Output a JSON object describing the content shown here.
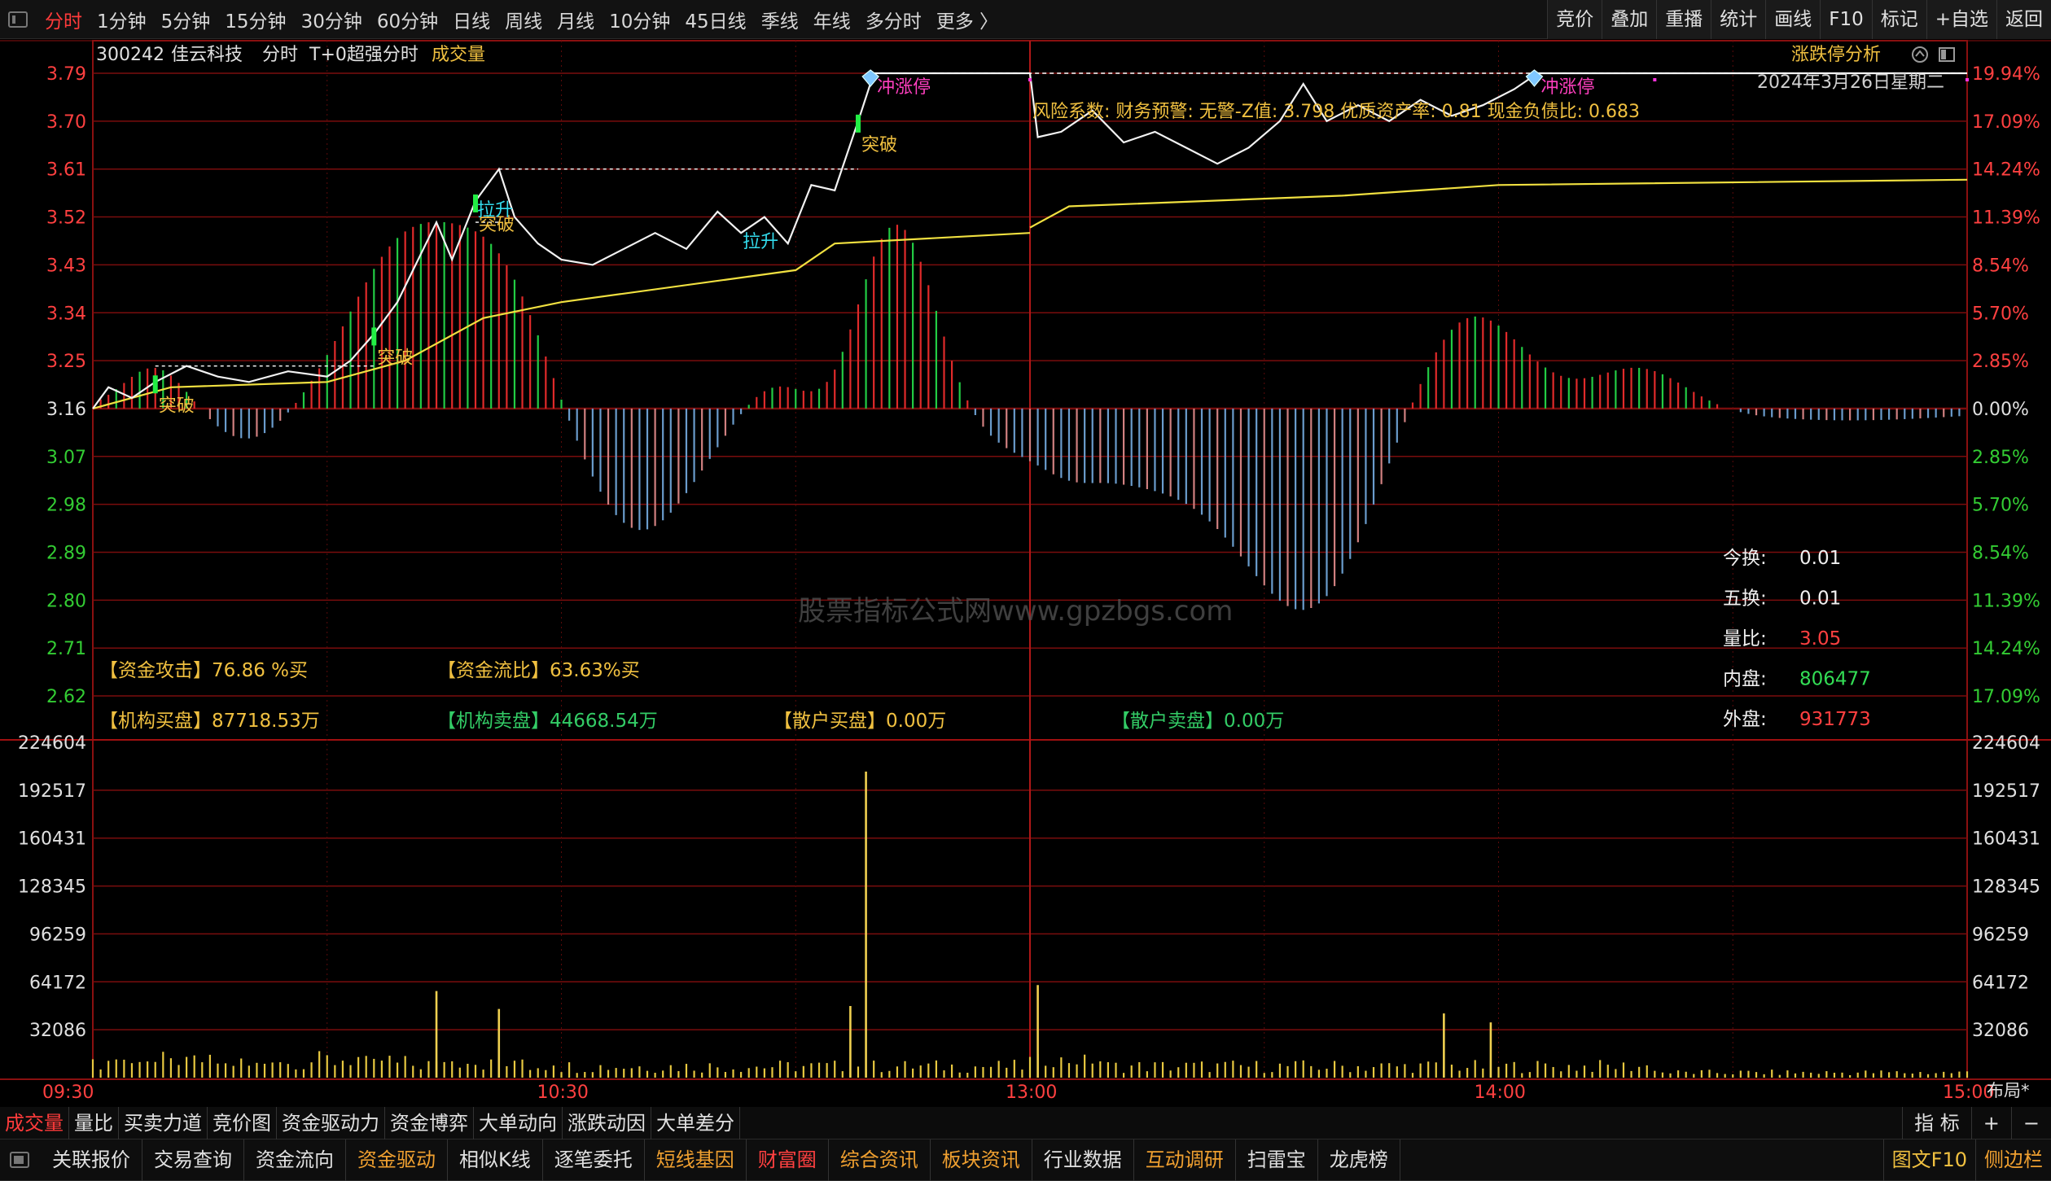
{
  "period_tabs": [
    "分时",
    "1分钟",
    "5分钟",
    "15分钟",
    "30分钟",
    "60分钟",
    "日线",
    "周线",
    "月线",
    "10分钟",
    "45日线",
    "季线",
    "年线",
    "多分时",
    "更多 〉"
  ],
  "active_period": "分时",
  "right_tools": [
    "竞价",
    "叠加",
    "重播",
    "统计",
    "画线",
    "F10",
    "标记",
    "+自选",
    "返回"
  ],
  "header": {
    "code": "300242",
    "name": "佳云科技",
    "mode": "分时",
    "indicator": "T+0超强分时",
    "volume_label": "成交量",
    "limit_label": "涨跌停分析",
    "date": "2024年3月26日星期二"
  },
  "price_axis": {
    "left": [
      "3.79",
      "3.70",
      "3.61",
      "3.52",
      "3.43",
      "3.34",
      "3.25",
      "3.16",
      "3.07",
      "2.98",
      "2.89",
      "2.80",
      "2.71",
      "2.62"
    ],
    "right": [
      "19.94%",
      "17.09%",
      "14.24%",
      "11.39%",
      "8.54%",
      "5.70%",
      "2.85%",
      "0.00%",
      "2.85%",
      "5.70%",
      "8.54%",
      "11.39%",
      "14.24%",
      "17.09%"
    ]
  },
  "volume_axis": [
    "224604",
    "192517",
    "160431",
    "128345",
    "96259",
    "64172",
    "32086"
  ],
  "time_axis": [
    "09:30",
    "10:30",
    "13:00",
    "14:00",
    "15:00"
  ],
  "layout_label": "布局*",
  "signals": {
    "breakout": "突破",
    "pull_up": "拉升",
    "limit_attempt": "冲涨停"
  },
  "risk_line": "风险系数: 财务预警: 无警-Z值: 3.798 优质资产率: 0.81 现金负债比: 0.683",
  "stats": [
    {
      "label": "今换:",
      "value": "0.01"
    },
    {
      "label": "五换:",
      "value": "0.01"
    },
    {
      "label": "量比:",
      "value": "3.05"
    },
    {
      "label": "内盘:",
      "value": "806477"
    },
    {
      "label": "外盘:",
      "value": "931773"
    }
  ],
  "fund_info": {
    "attack": "【资金攻击】76.86 %买",
    "flow_ratio": "【资金流比】63.63%买",
    "inst_buy": "【机构买盘】87718.53万",
    "inst_sell": "【机构卖盘】44668.54万",
    "retail_buy": "【散户买盘】0.00万",
    "retail_sell": "【散户卖盘】0.00万"
  },
  "watermark": "股票指标公式网www.gpzbgs.com",
  "indicator_tabs": [
    "成交量",
    "量比",
    "买卖力道",
    "竞价图",
    "资金驱动力",
    "资金博弈",
    "大单动向",
    "涨跌动因",
    "大单差分"
  ],
  "active_indicator_tab": "成交量",
  "tabbar_right": [
    "指 标",
    "+",
    "−"
  ],
  "bottom_tabs": [
    {
      "label": "关联报价",
      "color": "#e0e0e0"
    },
    {
      "label": "交易查询",
      "color": "#e0e0e0"
    },
    {
      "label": "资金流向",
      "color": "#e0e0e0"
    },
    {
      "label": "资金驱动",
      "color": "#f0a030"
    },
    {
      "label": "相似K线",
      "color": "#e0e0e0"
    },
    {
      "label": "逐笔委托",
      "color": "#e0e0e0"
    },
    {
      "label": "短线基因",
      "color": "#f0a030"
    },
    {
      "label": "财富圈",
      "color": "#ff4040"
    },
    {
      "label": "综合资讯",
      "color": "#f0a030"
    },
    {
      "label": "板块资讯",
      "color": "#f0a030"
    },
    {
      "label": "行业数据",
      "color": "#e0e0e0"
    },
    {
      "label": "互动调研",
      "color": "#f0a030"
    },
    {
      "label": "扫雷宝",
      "color": "#e0e0e0"
    },
    {
      "label": "龙虎榜",
      "color": "#e0e0e0"
    }
  ],
  "bottom_right": [
    "图文F10",
    "侧边栏"
  ],
  "chart_data": {
    "type": "line",
    "title": "300242 佳云科技 分时",
    "xlabel": "",
    "ylabel": "",
    "prev_close": 3.16,
    "limit_up": 3.79,
    "ylim_price": [
      2.62,
      3.79
    ],
    "ylim_volume": [
      0,
      224604
    ],
    "price_series": {
      "name": "price",
      "points": [
        [
          "09:30",
          3.16
        ],
        [
          "09:32",
          3.2
        ],
        [
          "09:35",
          3.18
        ],
        [
          "09:38",
          3.21
        ],
        [
          "09:42",
          3.24
        ],
        [
          "09:46",
          3.22
        ],
        [
          "09:50",
          3.21
        ],
        [
          "09:55",
          3.23
        ],
        [
          "10:00",
          3.22
        ],
        [
          "10:03",
          3.25
        ],
        [
          "10:06",
          3.3
        ],
        [
          "10:09",
          3.36
        ],
        [
          "10:12",
          3.45
        ],
        [
          "10:14",
          3.51
        ],
        [
          "10:16",
          3.44
        ],
        [
          "10:19",
          3.55
        ],
        [
          "10:22",
          3.61
        ],
        [
          "10:24",
          3.52
        ],
        [
          "10:27",
          3.47
        ],
        [
          "10:30",
          3.44
        ],
        [
          "10:34",
          3.43
        ],
        [
          "10:38",
          3.46
        ],
        [
          "10:42",
          3.49
        ],
        [
          "10:46",
          3.46
        ],
        [
          "10:50",
          3.53
        ],
        [
          "10:53",
          3.49
        ],
        [
          "10:56",
          3.52
        ],
        [
          "10:59",
          3.47
        ],
        [
          "11:02",
          3.58
        ],
        [
          "11:05",
          3.57
        ],
        [
          "11:08",
          3.7
        ],
        [
          "11:10",
          3.79
        ],
        [
          "11:30",
          3.79
        ],
        [
          "13:00",
          3.79
        ],
        [
          "13:01",
          3.67
        ],
        [
          "13:04",
          3.68
        ],
        [
          "13:08",
          3.72
        ],
        [
          "13:12",
          3.66
        ],
        [
          "13:16",
          3.68
        ],
        [
          "13:20",
          3.65
        ],
        [
          "13:24",
          3.62
        ],
        [
          "13:28",
          3.65
        ],
        [
          "13:32",
          3.7
        ],
        [
          "13:35",
          3.77
        ],
        [
          "13:38",
          3.7
        ],
        [
          "13:42",
          3.73
        ],
        [
          "13:46",
          3.7
        ],
        [
          "13:50",
          3.74
        ],
        [
          "13:54",
          3.71
        ],
        [
          "13:58",
          3.73
        ],
        [
          "14:02",
          3.76
        ],
        [
          "14:05",
          3.79
        ],
        [
          "14:10",
          3.79
        ],
        [
          "15:00",
          3.79
        ]
      ]
    },
    "avg_series": {
      "name": "average",
      "points": [
        [
          "09:30",
          3.16
        ],
        [
          "09:40",
          3.2
        ],
        [
          "10:00",
          3.21
        ],
        [
          "10:10",
          3.25
        ],
        [
          "10:20",
          3.33
        ],
        [
          "10:30",
          3.36
        ],
        [
          "11:00",
          3.42
        ],
        [
          "11:05",
          3.47
        ],
        [
          "11:30",
          3.49
        ],
        [
          "13:00",
          3.5
        ],
        [
          "13:05",
          3.54
        ],
        [
          "13:40",
          3.56
        ],
        [
          "14:00",
          3.58
        ],
        [
          "15:00",
          3.59
        ]
      ]
    },
    "signal_points": [
      {
        "time": "09:38",
        "label": "突破"
      },
      {
        "time": "10:06",
        "label": "突破"
      },
      {
        "time": "10:19",
        "label": "突破"
      },
      {
        "time": "10:19",
        "label": "拉升"
      },
      {
        "time": "10:53",
        "label": "拉升"
      },
      {
        "time": "11:08",
        "label": "突破"
      },
      {
        "time": "11:10",
        "label": "冲涨停"
      },
      {
        "time": "14:05",
        "label": "冲涨停"
      }
    ],
    "volume_spikes": [
      {
        "time": "10:14",
        "value": 58000
      },
      {
        "time": "10:22",
        "value": 46000
      },
      {
        "time": "11:07",
        "value": 48000
      },
      {
        "time": "11:09",
        "value": 205000
      },
      {
        "time": "13:01",
        "value": 62000
      },
      {
        "time": "13:53",
        "value": 43000
      },
      {
        "time": "13:59",
        "value": 37000
      }
    ]
  }
}
